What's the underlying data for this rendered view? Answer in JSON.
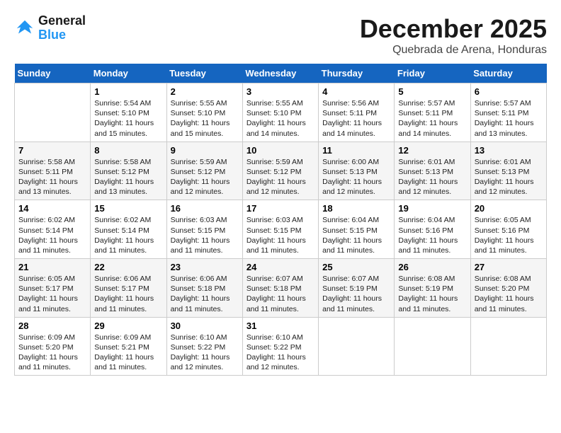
{
  "logo": {
    "line1": "General",
    "line2": "Blue"
  },
  "title": "December 2025",
  "subtitle": "Quebrada de Arena, Honduras",
  "weekdays": [
    "Sunday",
    "Monday",
    "Tuesday",
    "Wednesday",
    "Thursday",
    "Friday",
    "Saturday"
  ],
  "weeks": [
    [
      {
        "day": "",
        "info": ""
      },
      {
        "day": "1",
        "info": "Sunrise: 5:54 AM\nSunset: 5:10 PM\nDaylight: 11 hours\nand 15 minutes."
      },
      {
        "day": "2",
        "info": "Sunrise: 5:55 AM\nSunset: 5:10 PM\nDaylight: 11 hours\nand 15 minutes."
      },
      {
        "day": "3",
        "info": "Sunrise: 5:55 AM\nSunset: 5:10 PM\nDaylight: 11 hours\nand 14 minutes."
      },
      {
        "day": "4",
        "info": "Sunrise: 5:56 AM\nSunset: 5:11 PM\nDaylight: 11 hours\nand 14 minutes."
      },
      {
        "day": "5",
        "info": "Sunrise: 5:57 AM\nSunset: 5:11 PM\nDaylight: 11 hours\nand 14 minutes."
      },
      {
        "day": "6",
        "info": "Sunrise: 5:57 AM\nSunset: 5:11 PM\nDaylight: 11 hours\nand 13 minutes."
      }
    ],
    [
      {
        "day": "7",
        "info": "Sunrise: 5:58 AM\nSunset: 5:11 PM\nDaylight: 11 hours\nand 13 minutes."
      },
      {
        "day": "8",
        "info": "Sunrise: 5:58 AM\nSunset: 5:12 PM\nDaylight: 11 hours\nand 13 minutes."
      },
      {
        "day": "9",
        "info": "Sunrise: 5:59 AM\nSunset: 5:12 PM\nDaylight: 11 hours\nand 12 minutes."
      },
      {
        "day": "10",
        "info": "Sunrise: 5:59 AM\nSunset: 5:12 PM\nDaylight: 11 hours\nand 12 minutes."
      },
      {
        "day": "11",
        "info": "Sunrise: 6:00 AM\nSunset: 5:13 PM\nDaylight: 11 hours\nand 12 minutes."
      },
      {
        "day": "12",
        "info": "Sunrise: 6:01 AM\nSunset: 5:13 PM\nDaylight: 11 hours\nand 12 minutes."
      },
      {
        "day": "13",
        "info": "Sunrise: 6:01 AM\nSunset: 5:13 PM\nDaylight: 11 hours\nand 12 minutes."
      }
    ],
    [
      {
        "day": "14",
        "info": "Sunrise: 6:02 AM\nSunset: 5:14 PM\nDaylight: 11 hours\nand 11 minutes."
      },
      {
        "day": "15",
        "info": "Sunrise: 6:02 AM\nSunset: 5:14 PM\nDaylight: 11 hours\nand 11 minutes."
      },
      {
        "day": "16",
        "info": "Sunrise: 6:03 AM\nSunset: 5:15 PM\nDaylight: 11 hours\nand 11 minutes."
      },
      {
        "day": "17",
        "info": "Sunrise: 6:03 AM\nSunset: 5:15 PM\nDaylight: 11 hours\nand 11 minutes."
      },
      {
        "day": "18",
        "info": "Sunrise: 6:04 AM\nSunset: 5:15 PM\nDaylight: 11 hours\nand 11 minutes."
      },
      {
        "day": "19",
        "info": "Sunrise: 6:04 AM\nSunset: 5:16 PM\nDaylight: 11 hours\nand 11 minutes."
      },
      {
        "day": "20",
        "info": "Sunrise: 6:05 AM\nSunset: 5:16 PM\nDaylight: 11 hours\nand 11 minutes."
      }
    ],
    [
      {
        "day": "21",
        "info": "Sunrise: 6:05 AM\nSunset: 5:17 PM\nDaylight: 11 hours\nand 11 minutes."
      },
      {
        "day": "22",
        "info": "Sunrise: 6:06 AM\nSunset: 5:17 PM\nDaylight: 11 hours\nand 11 minutes."
      },
      {
        "day": "23",
        "info": "Sunrise: 6:06 AM\nSunset: 5:18 PM\nDaylight: 11 hours\nand 11 minutes."
      },
      {
        "day": "24",
        "info": "Sunrise: 6:07 AM\nSunset: 5:18 PM\nDaylight: 11 hours\nand 11 minutes."
      },
      {
        "day": "25",
        "info": "Sunrise: 6:07 AM\nSunset: 5:19 PM\nDaylight: 11 hours\nand 11 minutes."
      },
      {
        "day": "26",
        "info": "Sunrise: 6:08 AM\nSunset: 5:19 PM\nDaylight: 11 hours\nand 11 minutes."
      },
      {
        "day": "27",
        "info": "Sunrise: 6:08 AM\nSunset: 5:20 PM\nDaylight: 11 hours\nand 11 minutes."
      }
    ],
    [
      {
        "day": "28",
        "info": "Sunrise: 6:09 AM\nSunset: 5:20 PM\nDaylight: 11 hours\nand 11 minutes."
      },
      {
        "day": "29",
        "info": "Sunrise: 6:09 AM\nSunset: 5:21 PM\nDaylight: 11 hours\nand 11 minutes."
      },
      {
        "day": "30",
        "info": "Sunrise: 6:10 AM\nSunset: 5:22 PM\nDaylight: 11 hours\nand 12 minutes."
      },
      {
        "day": "31",
        "info": "Sunrise: 6:10 AM\nSunset: 5:22 PM\nDaylight: 11 hours\nand 12 minutes."
      },
      {
        "day": "",
        "info": ""
      },
      {
        "day": "",
        "info": ""
      },
      {
        "day": "",
        "info": ""
      }
    ]
  ]
}
